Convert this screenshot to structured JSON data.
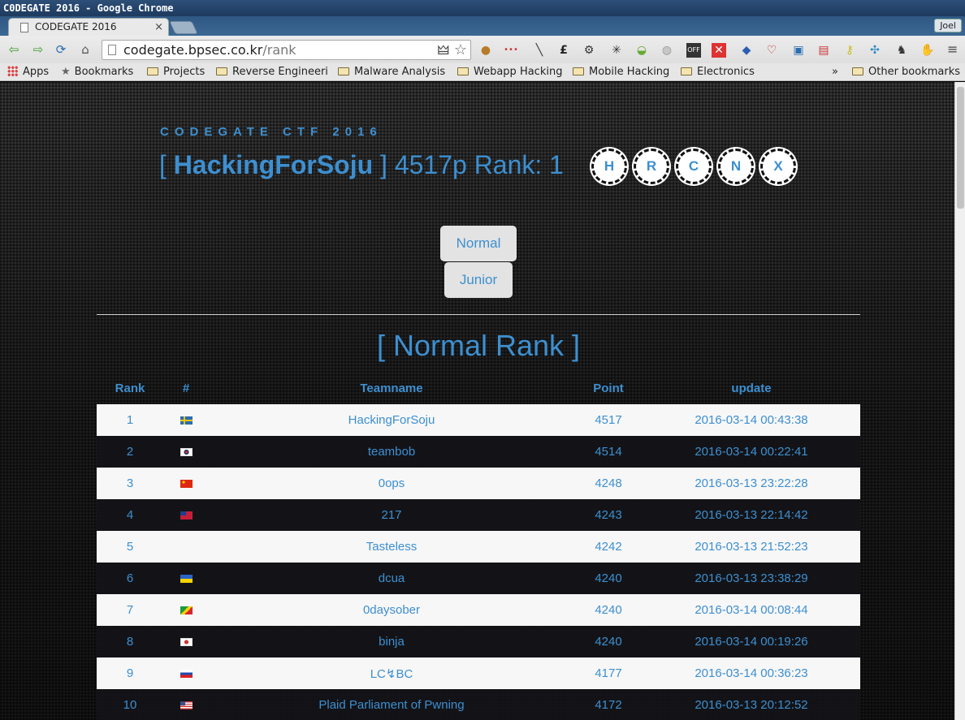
{
  "window": {
    "title": "C0DEGATE 2016 - Google Chrome"
  },
  "tab": {
    "title": "CODEGATE 2016",
    "close": "×"
  },
  "profile": {
    "name": "Joel"
  },
  "address": {
    "host": "codegate.bpsec.co.kr",
    "path": "/rank"
  },
  "bookmarks": {
    "apps": "Apps",
    "items": [
      "Bookmarks",
      "Projects",
      "Reverse Engineeri",
      "Malware Analysis",
      "Webapp Hacking",
      "Mobile Hacking",
      "Electronics"
    ],
    "overflow": "»",
    "other": "Other bookmarks"
  },
  "page": {
    "brand": "CODEGATE CTF 2016",
    "team_open": "[ ",
    "team": "HackingForSoju",
    "team_close": " ]",
    "points_rank": " 4517p Rank: 1",
    "badges": [
      "H",
      "R",
      "C",
      "N",
      "X"
    ],
    "modes": [
      "Normal",
      "Junior"
    ],
    "rank_title": "[ Normal Rank ]",
    "columns": [
      "Rank",
      "#",
      "Teamname",
      "Point",
      "update"
    ],
    "rows": [
      {
        "rank": "1",
        "flag": "sweden",
        "team": "HackingForSoju",
        "point": "4517",
        "update": "2016-03-14 00:43:38"
      },
      {
        "rank": "2",
        "flag": "south-korea",
        "team": "teambob",
        "point": "4514",
        "update": "2016-03-14 00:22:41"
      },
      {
        "rank": "3",
        "flag": "china",
        "team": "0ops",
        "point": "4248",
        "update": "2016-03-13 23:22:28"
      },
      {
        "rank": "4",
        "flag": "taiwan",
        "team": "217",
        "point": "4243",
        "update": "2016-03-13 22:14:42"
      },
      {
        "rank": "5",
        "flag": "",
        "team": "Tasteless",
        "point": "4242",
        "update": "2016-03-13 21:52:23"
      },
      {
        "rank": "6",
        "flag": "ukraine",
        "team": "dcua",
        "point": "4240",
        "update": "2016-03-13 23:38:29"
      },
      {
        "rank": "7",
        "flag": "congo",
        "team": "0daysober",
        "point": "4240",
        "update": "2016-03-14 00:08:44"
      },
      {
        "rank": "8",
        "flag": "japan",
        "team": "binja",
        "point": "4240",
        "update": "2016-03-14 00:19:26"
      },
      {
        "rank": "9",
        "flag": "russia",
        "team": "LC↯BC",
        "point": "4177",
        "update": "2016-03-14 00:36:23"
      },
      {
        "rank": "10",
        "flag": "usa",
        "team": "Plaid Parliament of Pwning",
        "point": "4172",
        "update": "2016-03-13 20:12:52"
      }
    ]
  }
}
